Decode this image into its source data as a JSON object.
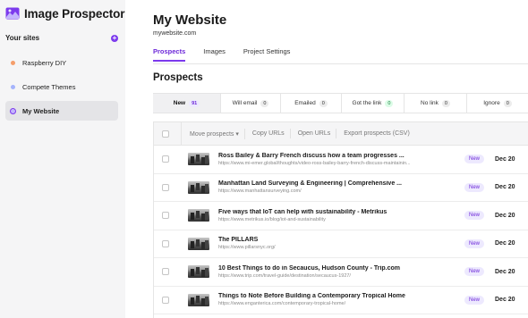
{
  "brand": {
    "name": "Image Prospector",
    "accent": "#7c3aed"
  },
  "sidebar": {
    "title": "Your sites",
    "add_label": "+",
    "sites": [
      {
        "label": "Raspberry DIY",
        "dot_color": "#f59e6b"
      },
      {
        "label": "Compete Themes",
        "dot_color": "#a5b4fc"
      },
      {
        "label": "My Website",
        "dot_color": "#7c3aed",
        "active": true
      }
    ]
  },
  "header": {
    "title": "My Website",
    "url": "mywebsite.com",
    "tabs": [
      {
        "label": "Prospects",
        "active": true
      },
      {
        "label": "Images"
      },
      {
        "label": "Project Settings"
      }
    ]
  },
  "prospects": {
    "title": "Prospects",
    "status_tabs": [
      {
        "label": "New",
        "count": "91",
        "style": "purple",
        "active": true
      },
      {
        "label": "Will email",
        "count": "0",
        "style": "gray"
      },
      {
        "label": "Emailed",
        "count": "0",
        "style": "gray"
      },
      {
        "label": "Got the link",
        "count": "0",
        "style": "green"
      },
      {
        "label": "No link",
        "count": "0",
        "style": "gray"
      },
      {
        "label": "Ignore",
        "count": "0",
        "style": "gray"
      }
    ],
    "toolbar": {
      "move": "Move prospects",
      "copy": "Copy URLs",
      "open": "Open URLs",
      "export": "Export prospects (CSV)"
    },
    "rows": [
      {
        "title": "Ross Bailey & Barry French discuss how a team progresses ...",
        "url": "https://www.mi-emer.global/thoughts/video-ross-bailey-barry-french-discuss-maintainin...",
        "status": "New",
        "date": "Dec 20"
      },
      {
        "title": "Manhattan Land Surveying & Engineering | Comprehensive ...",
        "url": "https://www.manhattansurveying.com/",
        "status": "New",
        "date": "Dec 20"
      },
      {
        "title": "Five ways that IoT can help with sustainability - Metrikus",
        "url": "https://www.metrikus.io/blog/iot-and-sustainability",
        "status": "New",
        "date": "Dec 20"
      },
      {
        "title": "The PILLARS",
        "url": "https://www.pillarsnyc.org/",
        "status": "New",
        "date": "Dec 20"
      },
      {
        "title": "10 Best Things to do in Secaucus, Hudson County - Trip.com",
        "url": "https://www.trip.com/travel-guide/destination/secaucus-1927/",
        "status": "New",
        "date": "Dec 20"
      },
      {
        "title": "Things to Note Before Building a Contemporary Tropical Home",
        "url": "https://www.enganterica.com/contemporary-tropical-home/",
        "status": "New",
        "date": "Dec 20"
      }
    ]
  }
}
